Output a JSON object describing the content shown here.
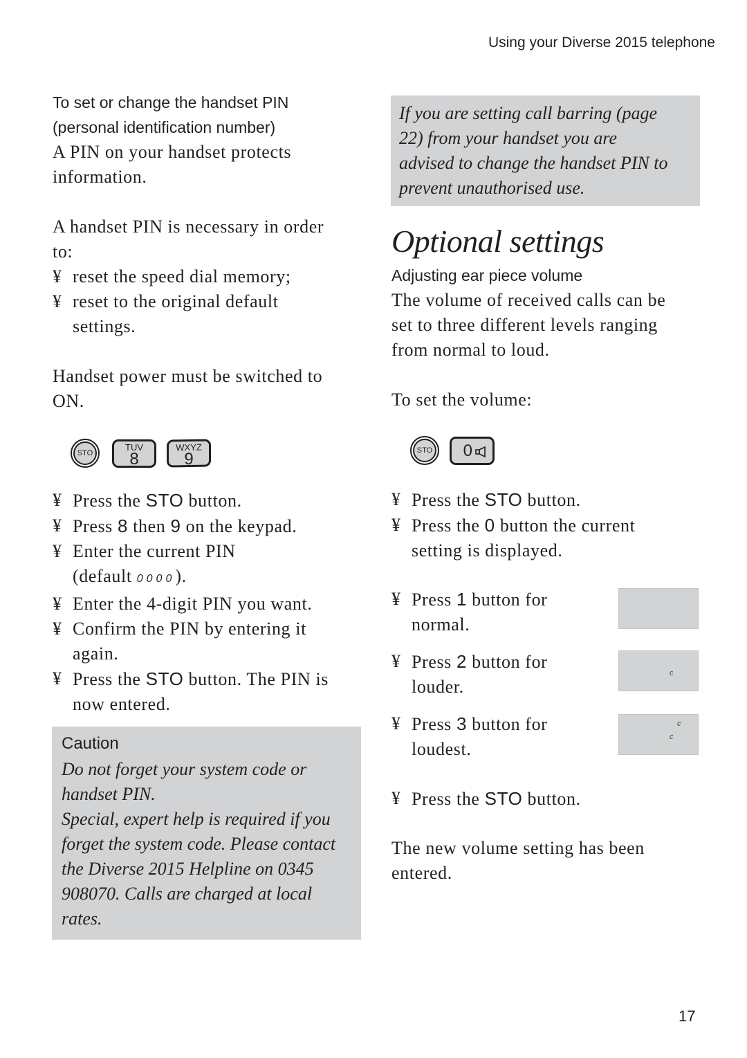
{
  "header": {
    "running_title": "Using your Diverse 2015 telephone"
  },
  "page_number": "17",
  "left": {
    "subheading_1": "To set or change the handset PIN",
    "subheading_2": "(personal identification number)",
    "intro": [
      "A PIN on your handset protects",
      "information."
    ],
    "necessary": [
      "A handset PIN is necessary in order",
      "to:"
    ],
    "bullets_1": [
      [
        "reset the speed dial memory;"
      ],
      [
        "reset to the original default",
        "settings."
      ]
    ],
    "power": [
      "Handset power must be switched to",
      "ON."
    ],
    "keys": {
      "sto": "STO",
      "key8": {
        "letters": "TUV",
        "digit": "8"
      },
      "key9": {
        "letters": "WXYZ",
        "digit": "9"
      }
    },
    "bullet_mark": "¥",
    "steps": {
      "s1a": "Press the ",
      "s1b": "STO",
      "s1c": " button.",
      "s2a": "Press ",
      "s2b": "8",
      "s2c": " then ",
      "s2d": "9",
      "s2e": " on the keypad.",
      "s3a": "Enter the current PIN",
      "s3b": "(default ",
      "s3c": "0000",
      "s3d": ").",
      "s4": "Enter the 4-digit PIN you want.",
      "s5a": "Confirm the PIN by entering it",
      "s5b": "again.",
      "s6a": "Press the ",
      "s6b": "STO",
      "s6c": " button. The PIN is",
      "s6d": "now entered."
    },
    "caution": {
      "title": "Caution",
      "lines": [
        "Do not forget your system code or",
        "handset PIN.",
        "Special, expert help is required if you",
        "forget the system code. Please contact",
        "the Diverse 2015 Helpline on 0345",
        "908070. Calls are charged at local",
        "rates."
      ]
    }
  },
  "right": {
    "note_lines": [
      "If you are setting call barring (page",
      "22) from your handset you are",
      "advised to change the handset PIN to",
      "prevent unauthorised use."
    ],
    "title": "Optional settings",
    "subheading": "Adjusting ear piece volume",
    "intro": [
      "The volume of received calls can be",
      "set to three different levels ranging",
      "from normal to loud."
    ],
    "to_set": "To set the volume:",
    "keys": {
      "sto": "STO",
      "key0": "0"
    },
    "steps": {
      "s1a": "Press the ",
      "s1b": "STO",
      "s1c": " button.",
      "s2a": "Press the ",
      "s2b": "0",
      "s2c": " button the current",
      "s2d": "setting is displayed."
    },
    "levels": [
      {
        "a": "Press ",
        "b": "1",
        "c": " button for",
        "d": "normal.",
        "marks": []
      },
      {
        "a": "Press ",
        "b": "2",
        "c": " button for",
        "d": "louder.",
        "marks": [
          "c"
        ]
      },
      {
        "a": "Press ",
        "b": "3",
        "c": " button for",
        "d": "loudest.",
        "marks": [
          "c",
          "c"
        ]
      }
    ],
    "final_step": {
      "a": "Press the ",
      "b": "STO",
      "c": " button."
    },
    "closing": [
      "The new volume setting has been",
      "entered."
    ]
  }
}
